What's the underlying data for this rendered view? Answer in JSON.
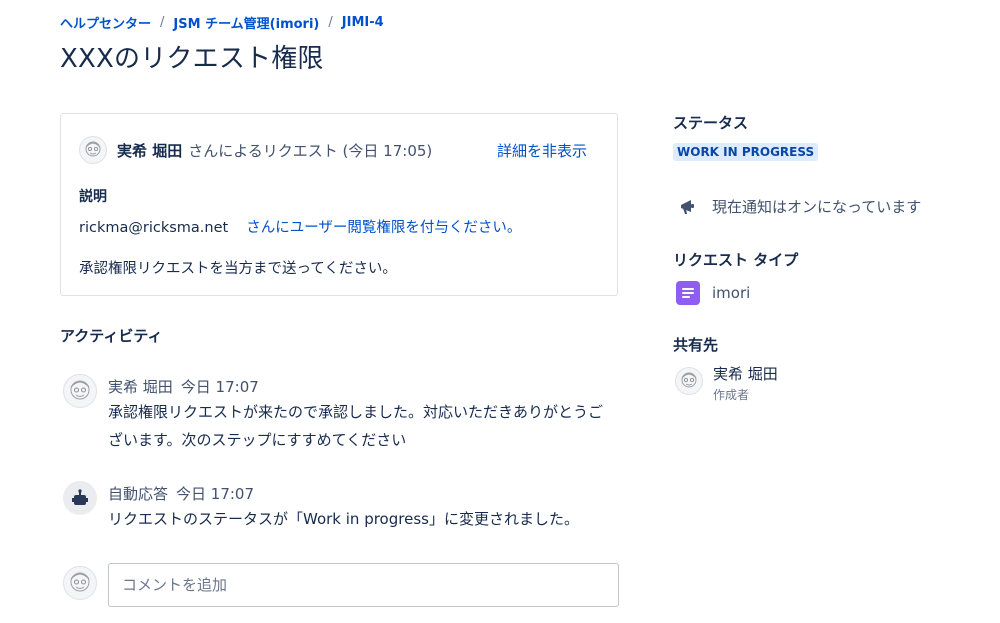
{
  "breadcrumb": {
    "items": [
      "ヘルプセンター",
      "JSM チーム管理(imori)",
      "JIMI-4"
    ],
    "separator": "/"
  },
  "page_title": "XXXのリクエスト権限",
  "request": {
    "requester_name": "実希 堀田",
    "requester_suffix": "さんによるリクエスト (今日 17:05)",
    "toggle_details": "詳細を非表示",
    "description_label": "説明",
    "description_email": "rickma@ricksma.net",
    "description_link": "さんにユーザー閲覧権限を付与ください。",
    "description_text": "承認権限リクエストを当方まで送ってください。"
  },
  "activity": {
    "title": "アクティビティ",
    "items": [
      {
        "author": "実希 堀田",
        "time": "今日 17:07",
        "text_line1": "承認権限リクエストが来たので承認しました。対応いただきありがとうご",
        "text_line2": "ざいます。次のステップにすすめてください"
      },
      {
        "author": "自動応答",
        "time": "今日 17:07",
        "text_line1": "リクエストのステータスが「Work in progress」に変更されました。"
      }
    ],
    "comment_placeholder": "コメントを追加"
  },
  "sidebar": {
    "status_heading": "ステータス",
    "status_value": "WORK IN PROGRESS",
    "notification_text": "現在通知はオンになっています",
    "request_type_heading": "リクエスト タイプ",
    "request_type_value": "imori",
    "shared_heading": "共有先",
    "shared_name": "実希 堀田",
    "shared_role": "作成者"
  },
  "colors": {
    "link": "#0052cc",
    "lozenge_bg": "#deebff",
    "lozenge_text": "#0747a6",
    "request_type_tile": "#8f5df2"
  },
  "icons": {
    "avatar": "sketch-avatar",
    "bot": "robot-icon",
    "notification": "megaphone-icon",
    "request_type": "document-lines-icon"
  }
}
